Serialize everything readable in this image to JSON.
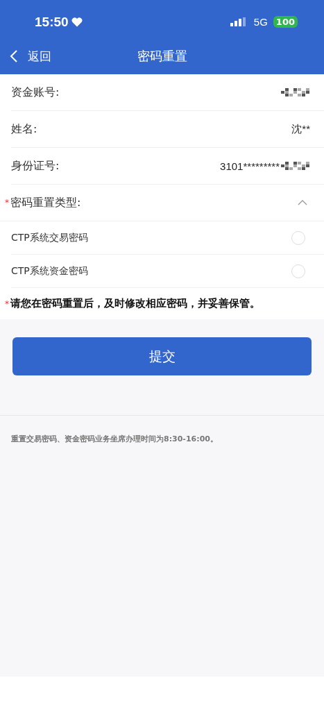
{
  "status_bar": {
    "time": "15:50",
    "network": "5G",
    "battery": "100"
  },
  "nav": {
    "back": "返回",
    "title": "密码重置"
  },
  "fields": [
    {
      "label": "资金账号:",
      "redacted": true
    },
    {
      "label": "姓名:",
      "value": "沈**",
      "redacted": false
    },
    {
      "label": "身份证号:",
      "value": "3101*********",
      "redacted": true
    }
  ],
  "reset_type": {
    "label": "密码重置类型:",
    "required_mark": "*",
    "expanded": true,
    "options": [
      {
        "label": "CTP系统交易密码",
        "selected": false
      },
      {
        "label": "CTP系统资金密码",
        "selected": false
      }
    ]
  },
  "notice": {
    "text": "请您在密码重置后，及时修改相应密码，并妥善保管。",
    "required_mark": "*"
  },
  "submit": "提交",
  "footer": "重置交易密码、资金密码业务坐席办理时间为8:30-16:00。"
}
